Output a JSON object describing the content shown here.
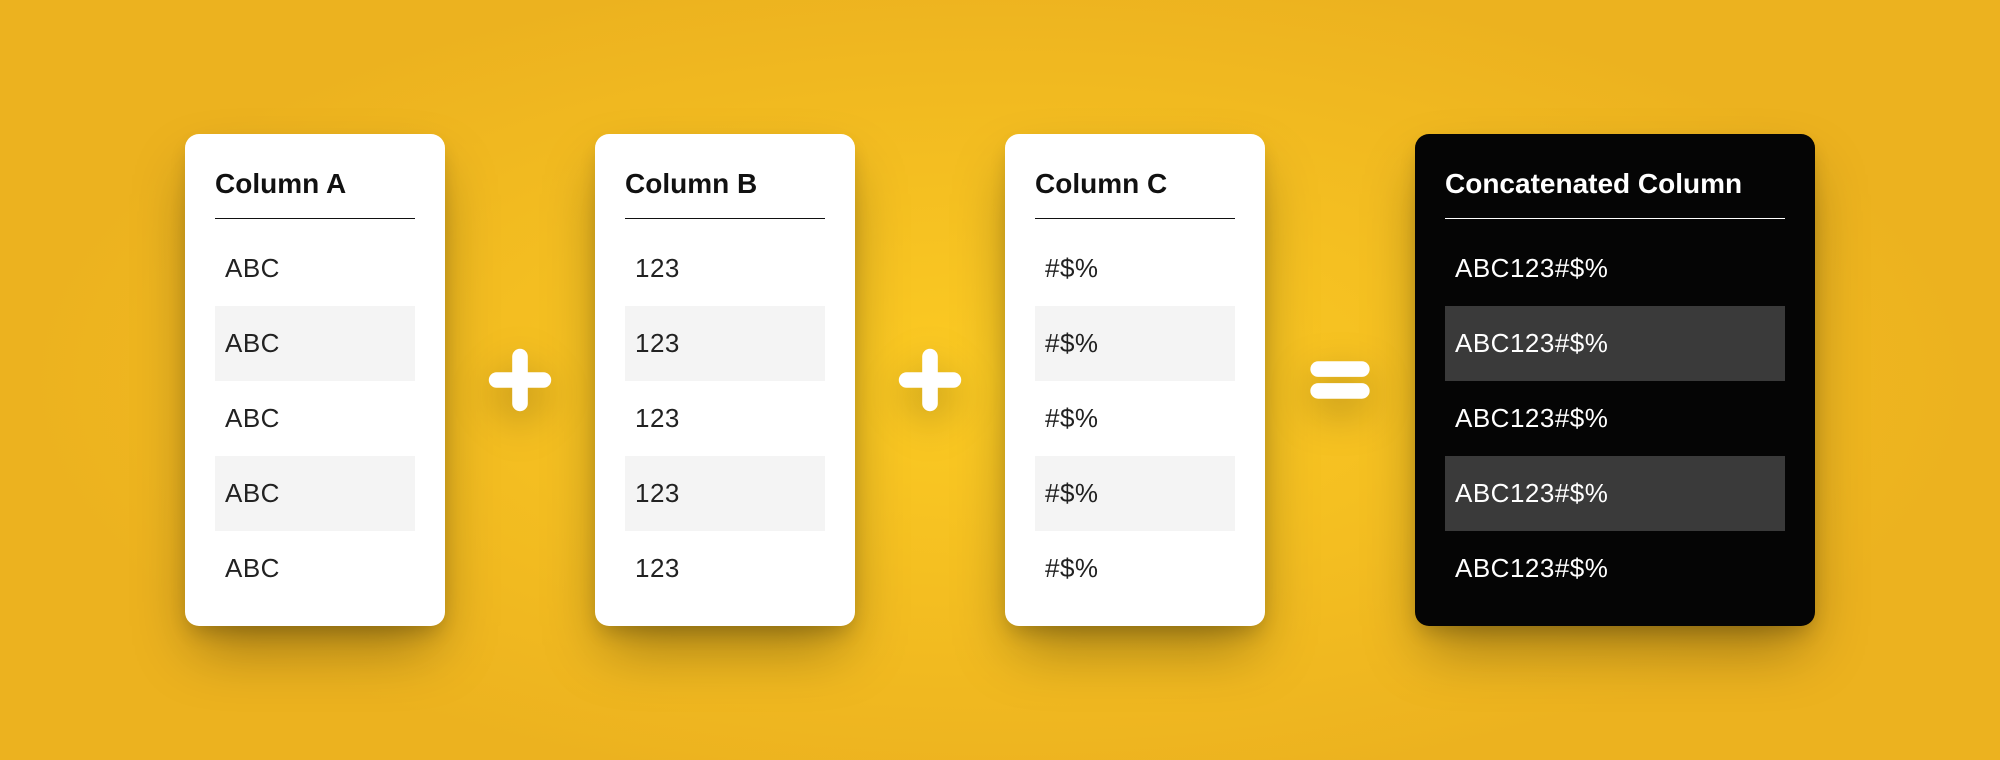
{
  "columns": {
    "a": {
      "header": "Column A",
      "rows": [
        "ABC",
        "ABC",
        "ABC",
        "ABC",
        "ABC"
      ]
    },
    "b": {
      "header": "Column B",
      "rows": [
        "123",
        "123",
        "123",
        "123",
        "123"
      ]
    },
    "c": {
      "header": "Column C",
      "rows": [
        "#$%",
        "#$%",
        "#$%",
        "#$%",
        "#$%"
      ]
    },
    "result": {
      "header": "Concatenated Column",
      "rows": [
        "ABC123#$%",
        "ABC123#$%",
        "ABC123#$%",
        "ABC123#$%",
        "ABC123#$%"
      ]
    }
  },
  "operators": {
    "plus": "+",
    "equals": "="
  }
}
